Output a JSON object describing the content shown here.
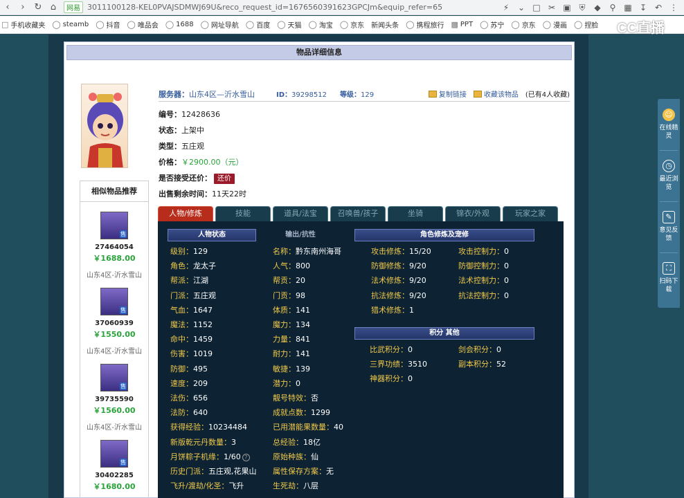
{
  "browser": {
    "site_tag": "网易",
    "url": "3011100128-KEL0PVAJSDMWJ69U&reco_request_id=1676560391623GPCJm&equip_refer=65",
    "bookmarks": [
      "手机收藏夹",
      "steamb",
      "抖音",
      "唯品会",
      "1688",
      "网址导航",
      "百度",
      "天猫",
      "淘宝",
      "京东",
      "新闻头条",
      "携程旅行",
      "PPT",
      "苏宁",
      "京东",
      "漫画",
      "捏脸"
    ],
    "overlay_logo": "CC直播"
  },
  "page": {
    "title": "物品详细信息",
    "server_label": "服务器：",
    "server_value": "山东4区—沂水雪山",
    "id_label": "ID：",
    "id_value": "39298512",
    "level_label": "等级：",
    "level_value": "129",
    "copy_link": "复制链接",
    "favorite": "收藏该物品",
    "fav_count": "(已有4人收藏)",
    "fields": [
      {
        "label": "编号：",
        "value": "12428636"
      },
      {
        "label": "状态：",
        "value": "上架中"
      },
      {
        "label": "类型：",
        "value": "五庄观"
      },
      {
        "label": "价格：",
        "value": "￥2900.00（元）"
      }
    ],
    "haggle_label": "是否接受还价：",
    "haggle_button": "还价",
    "time_label": "出售剩余时间：",
    "time_value": "11天22时"
  },
  "similar": {
    "title": "相似物品推荐",
    "sale_badge": "售",
    "items": [
      {
        "id": "27464054",
        "price": "￥1688.00",
        "server": "山东4区-沂水雪山"
      },
      {
        "id": "37060939",
        "price": "￥1550.00",
        "server": "山东4区-沂水雪山"
      },
      {
        "id": "39735590",
        "price": "￥1560.00",
        "server": "山东4区-沂水雪山"
      },
      {
        "id": "30402285",
        "price": "￥1680.00",
        "server": ""
      }
    ]
  },
  "tabs": [
    "人物/修炼",
    "技能",
    "道具/法宝",
    "召唤兽/孩子",
    "坐骑",
    "锦衣/外观",
    "玩家之家"
  ],
  "panels": {
    "status_header": "人物状态",
    "output_header": "输出/抗性",
    "cultivation_header": "角色修炼及宠修",
    "points_header": "积分 其他",
    "col1": [
      {
        "k": "级别：",
        "v": "129"
      },
      {
        "k": "角色：",
        "v": "龙太子"
      },
      {
        "k": "帮派：",
        "v": "江湖"
      },
      {
        "k": "门派：",
        "v": "五庄观"
      },
      {
        "k": "气血：",
        "v": "1647"
      },
      {
        "k": "魔法：",
        "v": "1152"
      },
      {
        "k": "命中：",
        "v": "1459"
      },
      {
        "k": "伤害：",
        "v": "1019"
      },
      {
        "k": "防御：",
        "v": "495"
      },
      {
        "k": "速度：",
        "v": "209"
      },
      {
        "k": "法伤：",
        "v": "656"
      },
      {
        "k": "法防：",
        "v": "640"
      },
      {
        "k": "获得经验：",
        "v": "10234484"
      },
      {
        "k": "新版乾元丹数量：",
        "v": "3"
      },
      {
        "k": "月饼粽子机缘：",
        "v": "1/60"
      },
      {
        "k": "历史门派：",
        "v": "五庄观,花果山"
      },
      {
        "k": "飞升/渡劫/化圣：",
        "v": "飞升"
      }
    ],
    "col2": [
      {
        "k": "名称：",
        "v": "黔东南州海哥"
      },
      {
        "k": "人气：",
        "v": "800"
      },
      {
        "k": "帮贡：",
        "v": "20"
      },
      {
        "k": "门贡：",
        "v": "98"
      },
      {
        "k": "体质：",
        "v": "141"
      },
      {
        "k": "魔力：",
        "v": "134"
      },
      {
        "k": "力量：",
        "v": "841"
      },
      {
        "k": "耐力：",
        "v": "141"
      },
      {
        "k": "敏捷：",
        "v": "139"
      },
      {
        "k": "潜力：",
        "v": "0"
      },
      {
        "k": "靓号特效：",
        "v": "否"
      },
      {
        "k": "成就点数：",
        "v": "1299"
      },
      {
        "k": "已用潜能果数量：",
        "v": "40"
      },
      {
        "k": "总经验：",
        "v": "18亿"
      },
      {
        "k": "原始种族：",
        "v": "仙"
      },
      {
        "k": "属性保存方案：",
        "v": "无"
      },
      {
        "k": "生死劫：",
        "v": "八层"
      }
    ],
    "cultivation": [
      {
        "k1": "攻击修炼：",
        "v1": "15/20",
        "k2": "攻击控制力：",
        "v2": "0"
      },
      {
        "k1": "防御修炼：",
        "v1": "9/20",
        "k2": "防御控制力：",
        "v2": "0"
      },
      {
        "k1": "法术修炼：",
        "v1": "9/20",
        "k2": "法术控制力：",
        "v2": "0"
      },
      {
        "k1": "抗法修炼：",
        "v1": "9/20",
        "k2": "抗法控制力：",
        "v2": "0"
      },
      {
        "k1": "猎术修炼：",
        "v1": "1",
        "k2": "",
        "v2": ""
      }
    ],
    "points": [
      {
        "k1": "比武积分：",
        "v1": "0",
        "k2": "剑会积分：",
        "v2": "0"
      },
      {
        "k1": "三界功绩：",
        "v1": "3510",
        "k2": "副本积分：",
        "v2": "52"
      },
      {
        "k1": "神器积分：",
        "v1": "0",
        "k2": "",
        "v2": ""
      }
    ]
  },
  "sidefloat": [
    {
      "icon": "avatar-icon",
      "label": "在线精灵"
    },
    {
      "icon": "clock-icon",
      "label": "最近浏览"
    },
    {
      "icon": "edit-icon",
      "label": "意见反馈"
    },
    {
      "icon": "scan-icon",
      "label": "扫码下载"
    }
  ],
  "colors": {
    "accent_tab": "#b72c1a",
    "price": "#2aa43a",
    "key_text": "#f0c94a",
    "panel_bg": "#0d2333"
  }
}
